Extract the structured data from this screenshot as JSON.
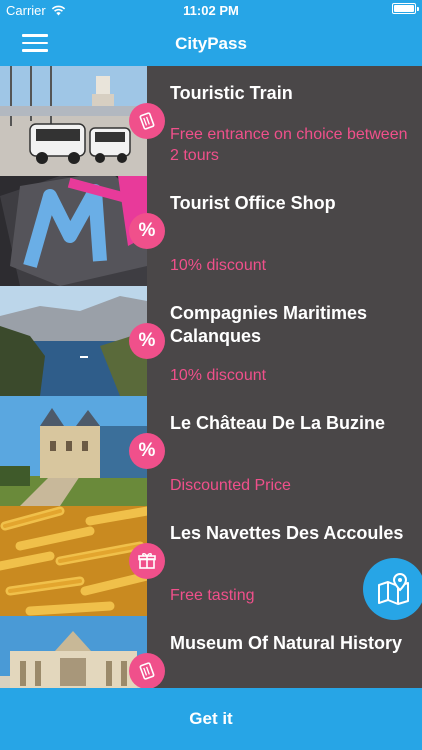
{
  "status_bar": {
    "carrier": "Carrier",
    "time": "11:02 PM"
  },
  "nav": {
    "title": "CityPass",
    "menu_icon": "hamburger-menu-icon"
  },
  "offers": [
    {
      "title": "Touristic Train",
      "offer": "Free entrance on choice between 2 tours",
      "badge_icon": "ticket-icon",
      "badge_text": ""
    },
    {
      "title": "Tourist Office Shop",
      "offer": "10% discount",
      "badge_icon": "percent-icon",
      "badge_text": "%"
    },
    {
      "title": "Compagnies Maritimes Calanques",
      "offer": "10% discount",
      "badge_icon": "percent-icon",
      "badge_text": "%"
    },
    {
      "title": "Le Château De La Buzine",
      "offer": "Discounted Price",
      "badge_icon": "percent-icon",
      "badge_text": "%"
    },
    {
      "title": "Les Navettes Des Accoules",
      "offer": "Free tasting",
      "badge_icon": "gift-icon",
      "badge_text": ""
    },
    {
      "title": "Museum Of Natural History",
      "offer": "",
      "badge_icon": "ticket-icon",
      "badge_text": ""
    }
  ],
  "map_button": {
    "icon": "map-pin-icon"
  },
  "cta": {
    "label": "Get it"
  },
  "colors": {
    "accent": "#27a5e6",
    "row_bg": "#4a4748",
    "offer_pink": "#f0508b"
  }
}
